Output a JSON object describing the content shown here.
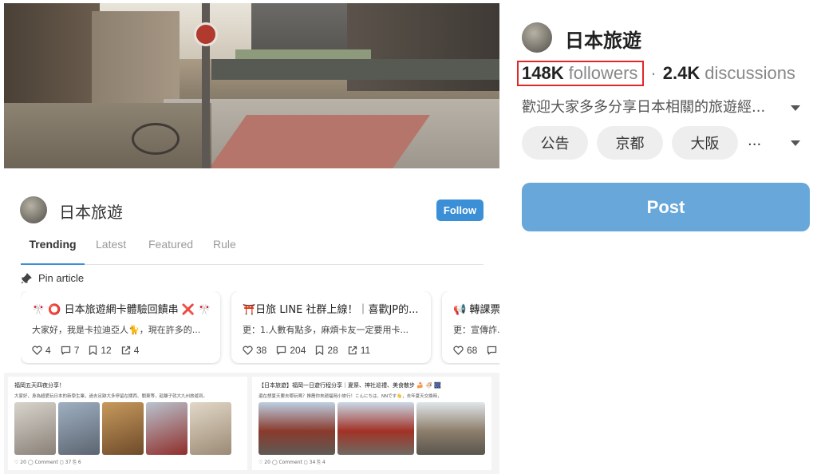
{
  "forum": {
    "name": "日本旅遊",
    "follow_label": "Follow",
    "tabs": [
      {
        "label": "Trending",
        "active": true
      },
      {
        "label": "Latest",
        "active": false
      },
      {
        "label": "Featured",
        "active": false
      },
      {
        "label": "Rule",
        "active": false
      }
    ],
    "pin_label": "Pin article",
    "pinned": [
      {
        "title": "🎌 ⭕ 日本旅遊網卡體驗回饋串 ❌ 🎌",
        "excerpt": "大家好，我是卡拉迪亞人🐈，現在許多的...",
        "likes": "4",
        "comments": "7",
        "saves": "12",
        "shares": "4"
      },
      {
        "title": "⛩️日旅 LINE 社群上線！｜喜歡JP的...",
        "excerpt": "更：1.人數有點多，麻煩卡友一定要用卡...",
        "likes": "38",
        "comments": "204",
        "saves": "28",
        "shares": "11"
      },
      {
        "title": "📢 轉課票...",
        "excerpt": "更：宣傳詐...",
        "likes": "68",
        "comments": "",
        "saves": "",
        "shares": ""
      }
    ],
    "feed": [
      {
        "title": "福岡五天四夜分享！",
        "excerpt": "大家好，身為超愛玩日本的新學生業，過去足跡大多停留在關西、關東等，趁離子就大九州旅遊到。",
        "stats": "♡ 20  ◯ Comment  ◻ 37  ⎘ 6"
      },
      {
        "title": "【日本旅遊】福岡一日遊行程分享｜夏祭、神社巡禮、美食散步 🍰 🍜 🎆",
        "excerpt": "還在想夏天要去哪玩嗎？推薦你來趟福岡小旅行！こんにちは、NNです👋，去年夏天交換時，",
        "stats": "♡ 20  ◯ Comment  ◻ 34  ⎘ 4"
      }
    ]
  },
  "panel": {
    "name": "日本旅遊",
    "followers_count": "148K",
    "followers_label": "followers",
    "separator": "·",
    "discussions_count": "2.4K",
    "discussions_label": "discussions",
    "description": "歡迎大家多多分享日本相關的旅遊經...",
    "chips": [
      "公告",
      "京都",
      "大阪"
    ],
    "more": "...",
    "post_label": "Post",
    "highlight_color": "#e0282a",
    "post_color": "#67a7d9"
  }
}
